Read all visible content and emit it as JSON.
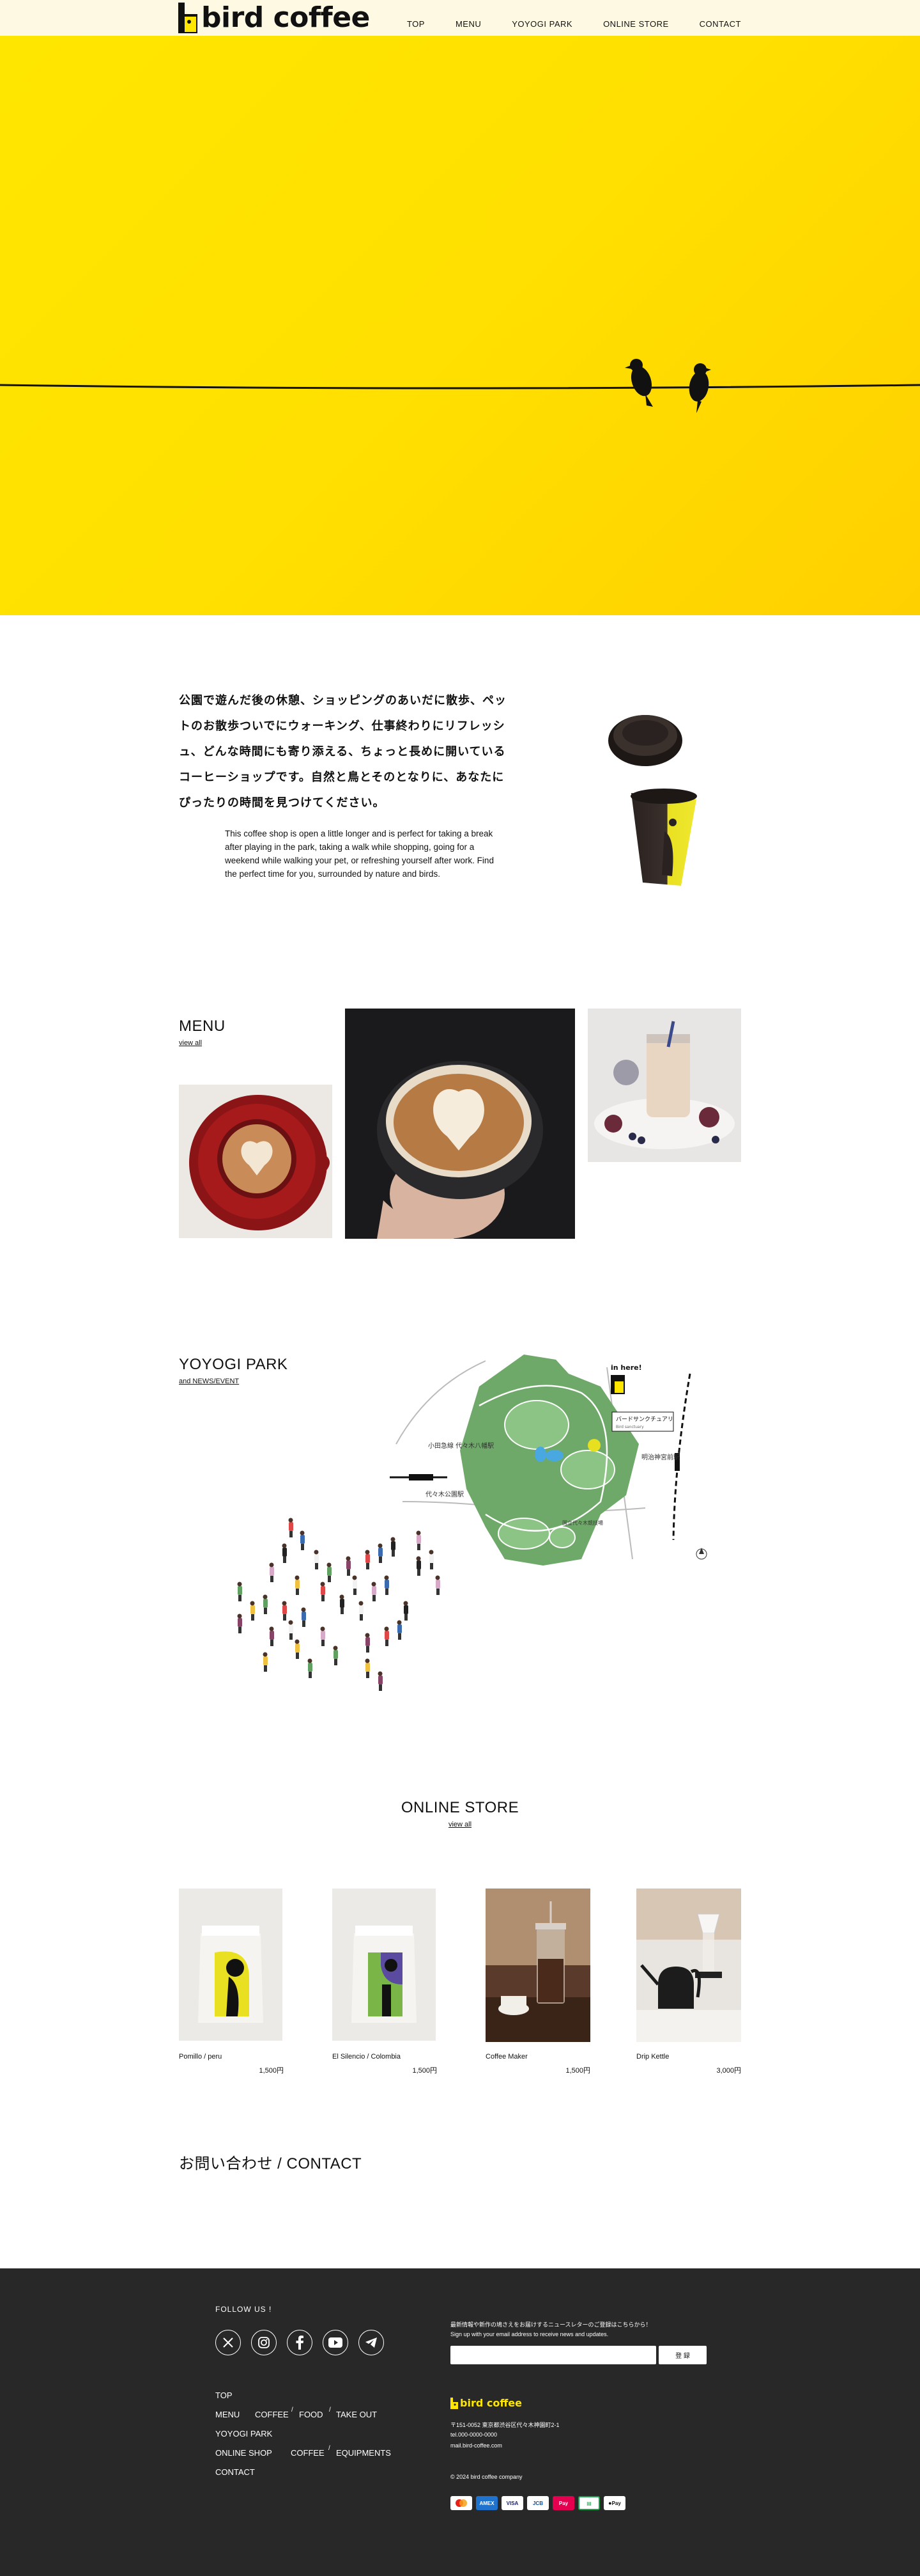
{
  "brand": {
    "name": "bird coffee"
  },
  "nav": {
    "items": [
      "TOP",
      "MENU",
      "YOYOGI PARK",
      "ONLINE STORE",
      "CONTACT"
    ]
  },
  "intro": {
    "jp": "公園で遊んだ後の休憩、ショッピングのあいだに散歩、ペットのお散歩ついでにウォーキング、仕事終わりにリフレッシュ、どんな時間にも寄り添える、ちょっと長めに開いているコーヒーショップです。自然と鳥とそのとなりに、あなたにぴったりの時間を見つけてください。",
    "en": "This coffee shop is open a little longer and is perfect for taking a break after playing in the park, taking a walk while shopping, going for a weekend while walking your pet, or refreshing yourself after work. Find the perfect time for you, surrounded by nature and birds."
  },
  "menu": {
    "title": "MENU",
    "link": "view all"
  },
  "park": {
    "title": "YOYOGI PARK",
    "link": "and NEWS/EVENT",
    "map": {
      "here": "in here!",
      "callout": "バードサンクチュアリ",
      "callout_sub": "Bird sanctuary",
      "station_harajuku": "JR山手線\n原宿駅",
      "station_yoyogi_hachiman": "小田急線\n代々木八幡駅",
      "station_yoyogi_koen": "東京メトロ千代田線\n代々木公園駅",
      "station_meiji": "東京メトロ千代田線\n明治神宮前駅",
      "gym": "国立代々木競技場"
    }
  },
  "store": {
    "title": "ONLINE STORE",
    "link": "view all",
    "products": [
      {
        "name": "Pomillo / peru",
        "price": "1,500円"
      },
      {
        "name": "El Silencio / Colombia",
        "price": "1,500円"
      },
      {
        "name": "Coffee Maker",
        "price": "1,500円"
      },
      {
        "name": "Drip Kettle",
        "price": "3,000円"
      }
    ]
  },
  "contact": {
    "title": "お問い合わせ / CONTACT"
  },
  "footer": {
    "follow": "FOLLOW US !",
    "newsletter_jp": "最新情報や新作の鳩さえをお届けするニュースレターのご登録はこちらから！",
    "newsletter_en": "Sign up with your email address to receive news and updates.",
    "submit": "登 録",
    "links": {
      "top": "TOP",
      "menu": "MENU",
      "coffee": "COFFEE",
      "food": "FOOD",
      "takeout": "TAKE OUT",
      "park": "YOYOGI PARK",
      "shop": "ONLINE SHOP",
      "shop_coffee": "COFFEE",
      "equipments": "EQUIPMENTS",
      "contact": "CONTACT"
    },
    "brand": "bird coffee",
    "address": "〒151-0052 東京都渋谷区代々木神園町2-1",
    "tel": "tel.000-0000-0000",
    "mail": "mail.bird-coffee.com",
    "copyright": "© 2024 bird coffee company",
    "payments": [
      "mastercard",
      "AMEX",
      "VISA",
      "JCB",
      "Pay",
      "SUICA",
      "Pay"
    ]
  },
  "icons": {
    "social": [
      "x-icon",
      "instagram-icon",
      "facebook-icon",
      "youtube-icon",
      "telegram-icon"
    ]
  },
  "colors": {
    "accent": "#ffe600",
    "dark": "#282828",
    "header": "#fdf9e3"
  }
}
